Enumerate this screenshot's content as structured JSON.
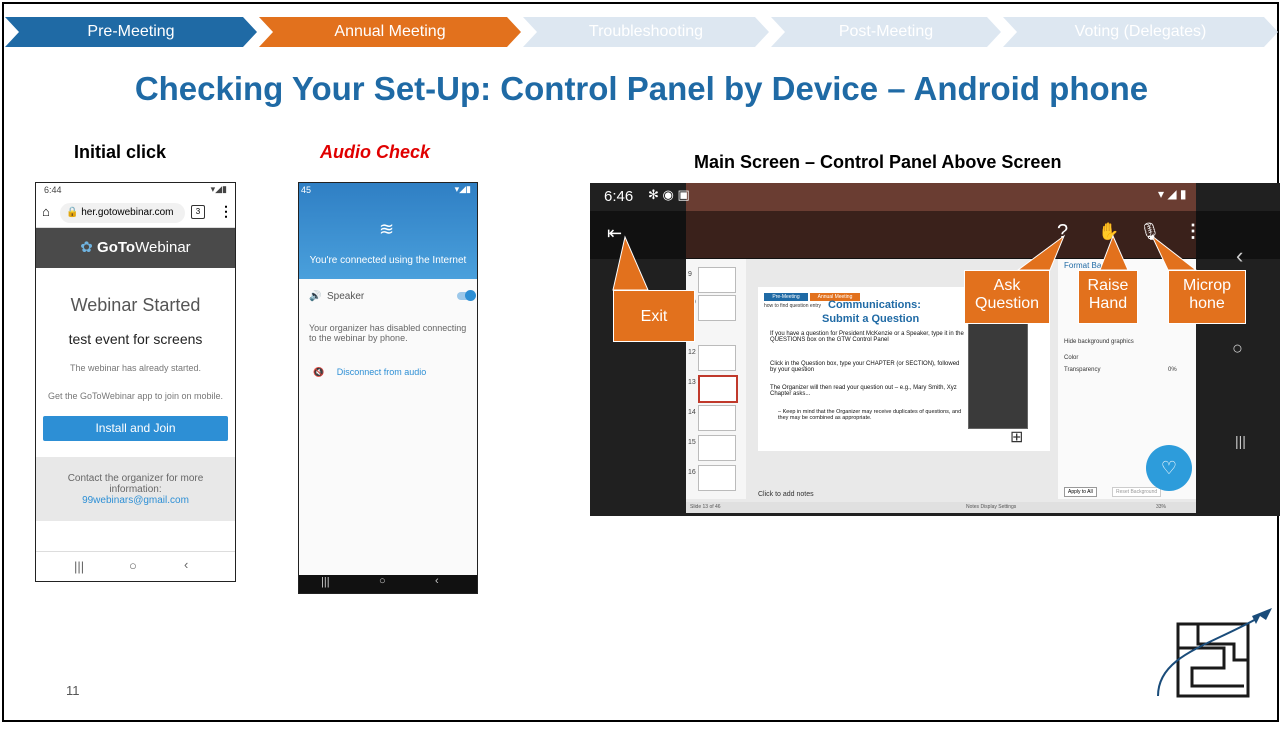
{
  "nav": {
    "tabs": [
      {
        "label": "Pre-Meeting",
        "color": "#1f6aa5",
        "text_color": "#ffffff"
      },
      {
        "label": "Annual Meeting",
        "color": "#e2711d",
        "text_color": "#ffffff"
      },
      {
        "label": "Troubleshooting",
        "color": "#dde7f1",
        "text_color": "#ffffff"
      },
      {
        "label": "Post-Meeting",
        "color": "#dde7f1",
        "text_color": "#ffffff"
      },
      {
        "label": "Voting (Delegates)",
        "color": "#dde7f1",
        "text_color": "#ffffff"
      }
    ]
  },
  "title": "Checking Your Set-Up: Control Panel by Device – Android phone",
  "labels": {
    "initial": "Initial click",
    "audio": "Audio Check",
    "main": "Main Screen – Control Panel Above Screen"
  },
  "phone1": {
    "time": "6:44",
    "url": "her.gotowebinar.com",
    "tab_count": "3",
    "brand_bold": "GoTo",
    "brand_light": "Webinar",
    "heading": "Webinar Started",
    "event": "test event for screens",
    "started_note": "The webinar has already started.",
    "app_note": "Get the GoToWebinar app to join on mobile.",
    "install_button": "Install and Join",
    "contact_line": "Contact the organizer for more information:",
    "contact_email": "99webinars@gmail.com"
  },
  "phone2": {
    "time": "45",
    "connected": "You're connected using the Internet",
    "speaker_label": "Speaker",
    "disabled_note": "Your organizer has disabled connecting to the webinar by phone.",
    "disconnect": "Disconnect from audio"
  },
  "main": {
    "time": "6:46",
    "slide_title_line1": "Communications:",
    "slide_title_line2": "Submit a Question",
    "mini_tab1": "Pre-Meeting",
    "mini_tab2": "Annual Meeting",
    "mini_subtitle": "how to find question entry",
    "bullets": [
      "If you have a question for President McKenzie or a Speaker, type it in the QUESTIONS box on the GTW Control Panel",
      "Click in the Question box, type your CHAPTER (or SECTION), followed by your question",
      "The Organizer will then read your question out – e.g., Mary Smith, Xyz Chapter asks...",
      "– Keep in mind that the Organizer may receive duplicates of questions, and they may be combined as appropriate."
    ],
    "notes": "Click to add notes",
    "format_bg": "Format Backgro...",
    "hide_bg": "Hide background graphics",
    "color_label": "Color",
    "transparency_label": "Transparency",
    "transparency_value": "0%",
    "apply_all": "Apply to All",
    "reset_bg": "Reset Background",
    "slide_thumbs": [
      "9",
      "10",
      "11",
      "12",
      "13",
      "14",
      "15",
      "16"
    ],
    "status_slide": "Slide 13 of 46",
    "status_right": "Notes   Display Settings",
    "zoom": "33%",
    "callouts": {
      "exit": "Exit",
      "ask": "Ask Question",
      "raise": "Raise Hand",
      "mic": "Microp hone"
    }
  },
  "slide_number": "11"
}
